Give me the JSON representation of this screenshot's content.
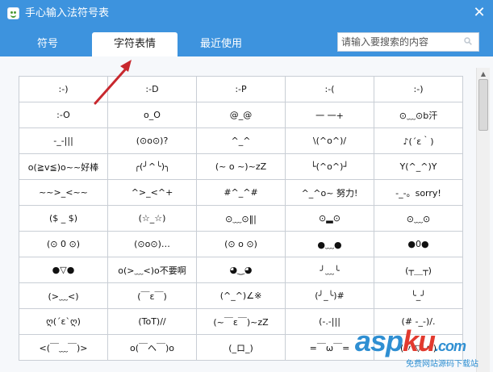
{
  "window": {
    "title": "手心输入法符号表",
    "close_glyph": "✕",
    "app_icon": "smiley-app-icon"
  },
  "tabs": [
    {
      "label": "符号",
      "active": false
    },
    {
      "label": "字符表情",
      "active": true
    },
    {
      "label": "最近使用",
      "active": false
    }
  ],
  "search": {
    "placeholder": "请输入要搜索的内容",
    "value": "",
    "icon": "search-icon"
  },
  "emoticons": [
    [
      ":-)",
      ":-D",
      ":-P",
      ":-(",
      ":-)"
    ],
    [
      ":-O",
      "o_O",
      "@_@",
      "一 一+",
      "⊙﹏⊙b汗"
    ],
    [
      "-_-|||",
      "(⊙o⊙)?",
      "^_^",
      "\\(^o^)/",
      "♪(´ε｀)"
    ],
    [
      "o(≧v≦)o~~好棒",
      "╭(╯^╰)╮",
      "(~ o ~)~zZ",
      "└(^o^)┘",
      "Y(^_^)Y"
    ],
    [
      "~~>_<~~",
      "^>_<^+",
      "#^_^#",
      "^_^o~ 努力!",
      "-_-。sorry!"
    ],
    [
      "($ _ $)",
      "(☆_☆)",
      "⊙﹏⊙‖|",
      "⊙▂⊙",
      "⊙﹏⊙"
    ],
    [
      "(⊙ 0 ⊙)",
      "(⊙o⊙)…",
      "(⊙ o ⊙)",
      "●﹏●",
      "●0●"
    ],
    [
      "●▽●",
      "o(>﹏<)o不要啊",
      "◕‿◕",
      "╯﹏╰",
      "(┬＿┬)"
    ],
    [
      "(>﹏<)",
      "(￣ε￣)",
      "(^_^)∠※",
      "(╯_╰)#",
      "╰_╯"
    ],
    [
      "ღ(´ε`ღ)",
      "(ToT)//",
      "(~￣ε￣)~zZ",
      "(-.-|||",
      "(# -_-)/."
    ],
    [
      "<(￣﹏￣)>",
      "o(￣ヘ￣)o",
      "(_ロ_)",
      "=￣ω￣=",
      "(〃'▽'〃)"
    ]
  ],
  "watermark": {
    "brand_a": "asp",
    "brand_b": "ku",
    "brand_c": ".com",
    "subtitle": "免费网站源码下载站"
  },
  "colors": {
    "titlebar": "#3d93de",
    "annotation_arrow": "#c8282e"
  }
}
